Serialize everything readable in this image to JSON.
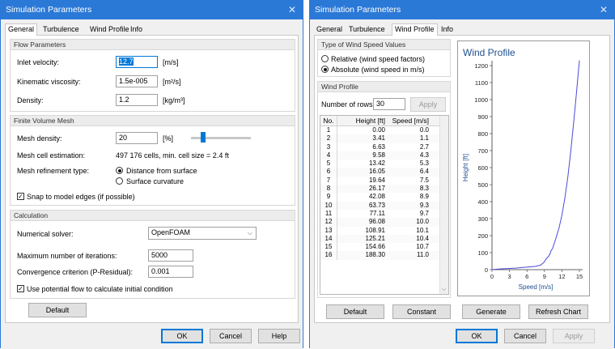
{
  "win1": {
    "title": "Simulation Parameters",
    "tabs": [
      "General",
      "Turbulence",
      "Wind Profile",
      "Info"
    ],
    "flow": {
      "header": "Flow Parameters",
      "inlet_label": "Inlet velocity:",
      "inlet_value": "12.7",
      "inlet_unit": "[m/s]",
      "visc_label": "Kinematic viscosity:",
      "visc_value": "1.5e-005",
      "visc_unit": "[m²/s]",
      "dens_label": "Density:",
      "dens_value": "1.2",
      "dens_unit": "[kg/m³]"
    },
    "mesh": {
      "header": "Finite Volume Mesh",
      "density_label": "Mesh density:",
      "density_value": "20",
      "density_unit": "[%]",
      "slider_fraction": 0.2,
      "cell_label": "Mesh cell estimation:",
      "cell_value": "497 176 cells, min. cell size = 2.4 ft",
      "refine_label": "Mesh refinement type:",
      "refine_opt1": "Distance from surface",
      "refine_opt2": "Surface curvature",
      "snap_label": "Snap to model edges (if possible)"
    },
    "calc": {
      "header": "Calculation",
      "solver_label": "Numerical solver:",
      "solver_value": "OpenFOAM",
      "iter_label": "Maximum number of iterations:",
      "iter_value": "5000",
      "conv_label": "Convergence criterion (P-Residual):",
      "conv_value": "0.001",
      "potential_label": "Use potential flow to calculate initial condition"
    },
    "default_btn": "Default",
    "ok_btn": "OK",
    "cancel_btn": "Cancel",
    "help_btn": "Help"
  },
  "win2": {
    "title": "Simulation Parameters",
    "tabs": [
      "General",
      "Turbulence",
      "Wind Profile",
      "Info"
    ],
    "type_header": "Type of Wind Speed Values",
    "radio_rel": "Relative (wind speed factors)",
    "radio_abs": "Absolute (wind speed in m/s)",
    "profile_header": "Wind Profile",
    "rows_label": "Number of rows:",
    "rows_value": "30",
    "apply_small": "Apply",
    "table": {
      "headers": [
        "No.",
        "Height [ft]",
        "Speed [m/s]"
      ],
      "rows": [
        [
          "1",
          "0.00",
          "0.0"
        ],
        [
          "2",
          "3.41",
          "1.1"
        ],
        [
          "3",
          "6.63",
          "2.7"
        ],
        [
          "4",
          "9.58",
          "4.3"
        ],
        [
          "5",
          "13.42",
          "5.3"
        ],
        [
          "6",
          "16.05",
          "6.4"
        ],
        [
          "7",
          "19.64",
          "7.5"
        ],
        [
          "8",
          "26.17",
          "8.3"
        ],
        [
          "9",
          "42.08",
          "8.9"
        ],
        [
          "10",
          "63.73",
          "9.3"
        ],
        [
          "11",
          "77.11",
          "9.7"
        ],
        [
          "12",
          "96.08",
          "10.0"
        ],
        [
          "13",
          "108.91",
          "10.1"
        ],
        [
          "14",
          "125.21",
          "10.4"
        ],
        [
          "15",
          "154.66",
          "10.7"
        ],
        [
          "16",
          "188.30",
          "11.0"
        ]
      ]
    },
    "default_btn": "Default",
    "constant_btn": "Constant",
    "generate_btn": "Generate",
    "refresh_btn": "Refresh Chart",
    "ok_btn": "OK",
    "cancel_btn": "Cancel",
    "apply_btn": "Apply"
  },
  "chart_data": {
    "type": "line",
    "title": "Wind Profile",
    "xlabel": "Speed [m/s]",
    "ylabel": "Height [ft]",
    "xlim": [
      0,
      15
    ],
    "ylim": [
      0,
      1200
    ],
    "xticks": [
      0,
      3,
      6,
      9,
      12,
      15
    ],
    "yticks": [
      0,
      100,
      200,
      300,
      400,
      500,
      600,
      700,
      800,
      900,
      1000,
      1100,
      1200
    ],
    "line_color": "#4a4ad8",
    "series": [
      {
        "x": [
          0.0,
          1.1,
          2.7,
          4.3,
          5.3,
          6.4,
          7.5,
          8.3,
          8.9,
          9.3,
          9.7,
          10.0,
          10.1,
          10.4,
          10.7,
          11.0,
          11.5,
          12.0,
          12.5,
          13.0,
          13.5,
          14.0,
          14.5,
          15.0
        ],
        "y": [
          0.0,
          3.41,
          6.63,
          9.58,
          13.42,
          16.05,
          19.64,
          26.17,
          42.08,
          63.73,
          77.11,
          96.08,
          108.91,
          125.21,
          154.66,
          188.3,
          245,
          320,
          420,
          540,
          690,
          860,
          1040,
          1230
        ]
      }
    ]
  }
}
